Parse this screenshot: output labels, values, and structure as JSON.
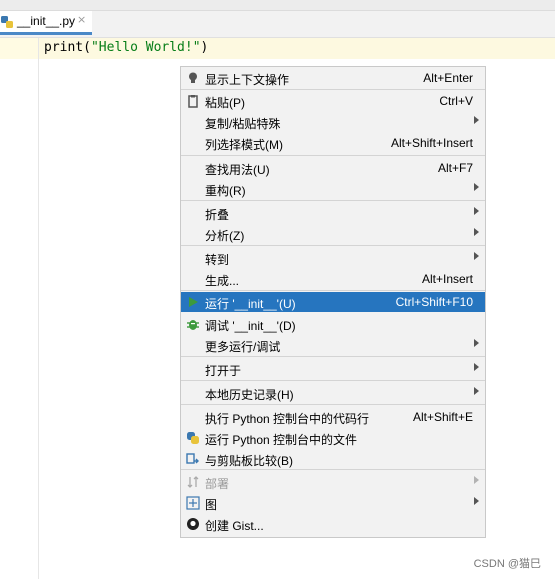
{
  "tab": {
    "label": "__init__.py",
    "close": "×"
  },
  "editor": {
    "code_fn": "print(",
    "code_str": "\"Hello World!\"",
    "code_end": ")"
  },
  "menu": {
    "items": [
      {
        "label": "显示上下文操作",
        "shortcut": "Alt+Enter",
        "icon": "bulb-icon"
      },
      {
        "label": "粘贴(P)",
        "shortcut": "Ctrl+V",
        "icon": "clipboard-icon"
      },
      {
        "label": "复制/粘贴特殊",
        "submenu": true
      },
      {
        "label": "列选择模式(M)",
        "shortcut": "Alt+Shift+Insert"
      },
      {
        "label": "查找用法(U)",
        "shortcut": "Alt+F7"
      },
      {
        "label": "重构(R)",
        "submenu": true
      },
      {
        "label": "折叠",
        "submenu": true
      },
      {
        "label": "分析(Z)",
        "submenu": true
      },
      {
        "label": "转到",
        "submenu": true
      },
      {
        "label": "生成...",
        "shortcut": "Alt+Insert"
      },
      {
        "label": "运行 '__init__'(U)",
        "shortcut": "Ctrl+Shift+F10",
        "icon": "run-icon",
        "selected": true
      },
      {
        "label": "调试 '__init__'(D)",
        "icon": "debug-icon"
      },
      {
        "label": "更多运行/调试",
        "submenu": true
      },
      {
        "label": "打开于",
        "submenu": true
      },
      {
        "label": "本地历史记录(H)",
        "submenu": true
      },
      {
        "label": "执行 Python 控制台中的代码行",
        "shortcut": "Alt+Shift+E"
      },
      {
        "label": "运行 Python 控制台中的文件",
        "icon": "python-icon"
      },
      {
        "label": "与剪贴板比较(B)",
        "icon": "compare-icon"
      },
      {
        "label": "部署",
        "submenu": true,
        "disabled": true,
        "icon": "deploy-icon"
      },
      {
        "label": "图",
        "submenu": true,
        "icon": "diagram-icon"
      },
      {
        "label": "创建 Gist...",
        "icon": "github-icon"
      }
    ]
  },
  "watermark": "CSDN @猫巳",
  "colors": {
    "selection": "#2675bf",
    "run_green": "#3d9a3d",
    "string_green": "#067d17"
  }
}
